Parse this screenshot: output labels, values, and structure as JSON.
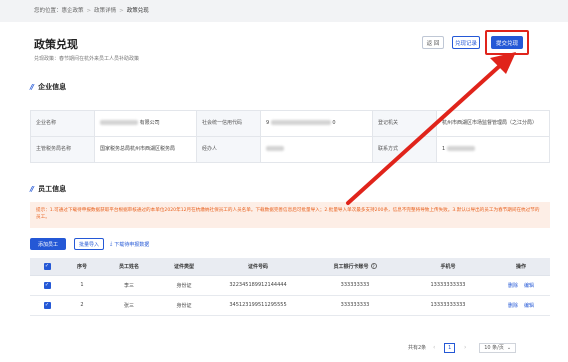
{
  "breadcrumb": {
    "prefix": "您的位置：",
    "items": [
      "惠企政策",
      "政策详情",
      "政策兑现"
    ],
    "separator": ">"
  },
  "header": {
    "title": "政策兑现",
    "subtitle": "兑现政策：春节期间在杭外来员工人员补助政策",
    "back_label": "返 回",
    "record_label": "兑现记录",
    "submit_label": "提交兑现"
  },
  "company_section": {
    "title": "企业信息",
    "fields": {
      "name_key": "企业名称",
      "name_value_suffix": "有限公司",
      "credit_code_key": "社会统一信用代码",
      "credit_code_prefix": "9",
      "credit_code_suffix": "0",
      "registration_key": "登记机关",
      "registration_value": "杭州市西湖区市场监督管理局（之江分局）",
      "tax_office_key": "主管税务局名称",
      "tax_office_value": "国家税务总局杭州市西湖区税务局",
      "handler_key": "经办人",
      "contact_key": "联系方式",
      "contact_prefix": "1"
    }
  },
  "employee_section": {
    "title": "员工信息",
    "notice": "提示：1.可通过下载待申报数据获取平台根据审核通过的本单位2020年12月在杭缴纳社保员工的人员名单。下载数据完善信息后可批量导入；2.批量导入单次最多支持200条，信息不完整将导致上传失败。3.默认以导出的员工为春节期间在杭过节的员工。",
    "add_label": "添加员工",
    "import_label": "批量导入",
    "download_label": "下载待申报数据",
    "columns": [
      "序号",
      "员工姓名",
      "证件类型",
      "证件号码",
      "员工银行卡账号",
      "手机号",
      "操作"
    ],
    "rows": [
      {
        "index": "1",
        "name": "李三",
        "id_type": "身份证",
        "id_number": "322345189912144444",
        "bank_account": "333333333",
        "phone": "13333333333"
      },
      {
        "index": "2",
        "name": "张三",
        "id_type": "身份证",
        "id_number": "345123199511295555",
        "bank_account": "333333333",
        "phone": "13333333333"
      }
    ],
    "delete_label": "删除",
    "edit_label": "编辑"
  },
  "pagination": {
    "total_label": "共有2条",
    "current_page": "1",
    "page_size_label": "10 条/页"
  },
  "colors": {
    "primary": "#2458d6",
    "highlight": "#e0241b",
    "notice_text": "#e8611e",
    "notice_bg": "#fdeee6"
  }
}
